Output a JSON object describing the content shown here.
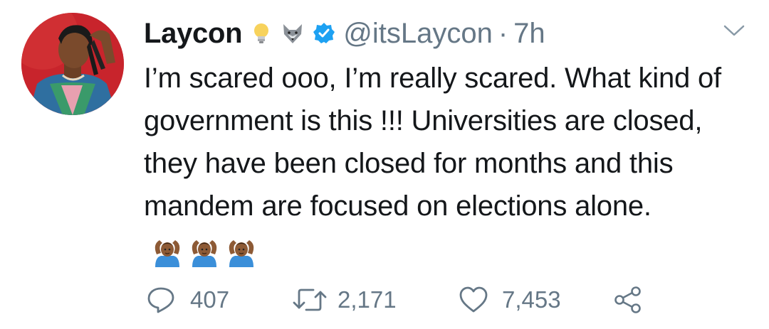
{
  "tweet": {
    "display_name": "Laycon",
    "handle": "@itsLaycon",
    "separator": "·",
    "time": "7h",
    "text": "I’m scared ooo, I’m really scared. What kind of government is this !!! Universities are closed, they have been closed for months and this mandem are focused on elections alone.",
    "name_icons": [
      "lightbulb-icon",
      "wolf-icon",
      "verified-badge-icon"
    ],
    "emojis": [
      "man-gesturing-ok-emoji",
      "man-gesturing-ok-emoji",
      "man-gesturing-ok-emoji"
    ]
  },
  "actions": {
    "reply_count": "407",
    "retweet_count": "2,171",
    "like_count": "7,453"
  },
  "colors": {
    "text": "#14171a",
    "secondary": "#657786",
    "verified": "#1da1f2",
    "avatar_bg": "#c8242c"
  }
}
